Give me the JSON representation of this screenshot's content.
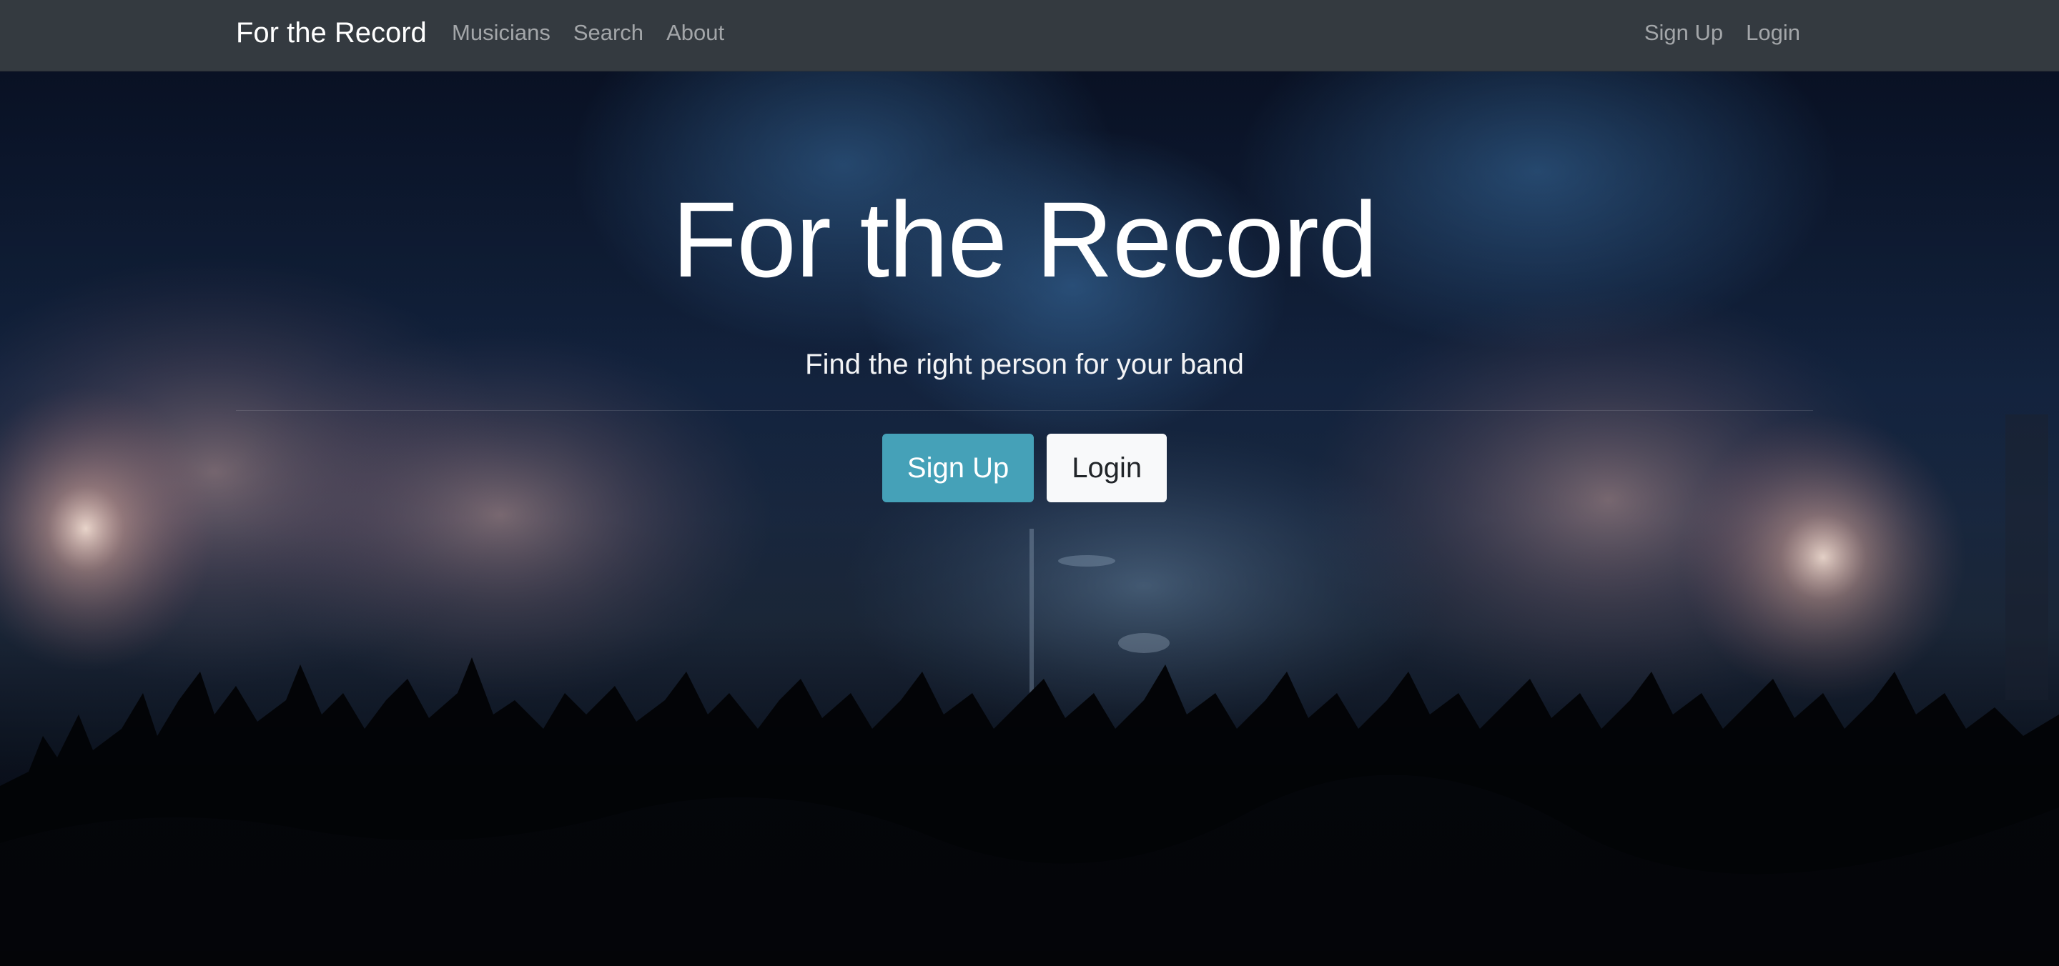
{
  "navbar": {
    "brand": "For the Record",
    "left_links": [
      {
        "label": "Musicians"
      },
      {
        "label": "Search"
      },
      {
        "label": "About"
      }
    ],
    "right_links": [
      {
        "label": "Sign Up"
      },
      {
        "label": "Login"
      }
    ]
  },
  "hero": {
    "title": "For the Record",
    "lead": "Find the right person for your band",
    "buttons": {
      "signup_label": "Sign Up",
      "login_label": "Login"
    },
    "background": {
      "description_icon": "concert-crowd-image"
    }
  },
  "colors": {
    "navbar_bg": "#343a40",
    "info_button": "#45a1b8",
    "light_button": "#f8f9fa",
    "nav_link": "rgba(255,255,255,0.55)"
  }
}
